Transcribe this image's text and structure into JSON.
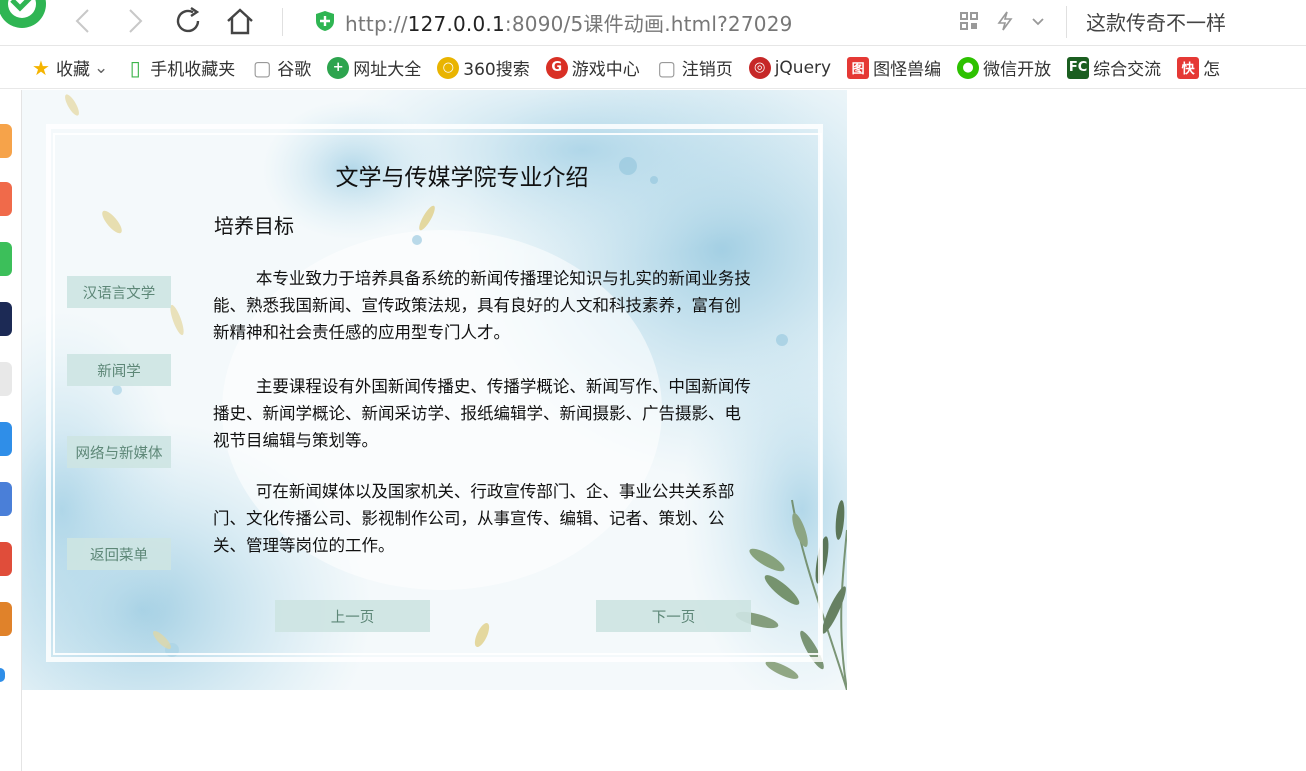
{
  "browser": {
    "url_prefix": "http://",
    "url_host": "127.0.0.1",
    "url_rest": ":8090/5课件动画.html?27029",
    "slogan": "这款传奇不一样",
    "icons": [
      "back-icon",
      "forward-icon",
      "reload-icon",
      "home-icon",
      "security-shield-icon",
      "qr-code-icon",
      "lightning-icon",
      "chevron-down-icon"
    ]
  },
  "bookmarks": [
    {
      "label": "收藏",
      "icon": "star-icon",
      "color": "#f5b400"
    },
    {
      "label": "手机收藏夹",
      "icon": "phone-icon",
      "color": "#3cb44b"
    },
    {
      "label": "谷歌",
      "icon": "page-icon",
      "color": "#999999"
    },
    {
      "label": "网址大全",
      "icon": "plus-circle-icon",
      "color": "#2da44e"
    },
    {
      "label": "360搜索",
      "icon": "360-icon",
      "color": "#e9b400"
    },
    {
      "label": "游戏中心",
      "icon": "game-icon",
      "color": "#d93025"
    },
    {
      "label": "注销页",
      "icon": "page-icon",
      "color": "#999999"
    },
    {
      "label": "jQuery",
      "icon": "jquery-icon",
      "color": "#c62828"
    },
    {
      "label": "图怪兽编",
      "icon": "tuguaishou-icon",
      "color": "#e53935"
    },
    {
      "label": "微信开放",
      "icon": "wechat-icon",
      "color": "#2dc100"
    },
    {
      "label": "综合交流",
      "icon": "fc-icon",
      "color": "#1b5e20"
    },
    {
      "label": "怎",
      "icon": "kuai-icon",
      "color": "#e53935"
    }
  ],
  "page": {
    "title": "文学与传媒学院专业介绍",
    "subtitle": "培养目标",
    "paragraphs": [
      "本专业致力于培养具备系统的新闻传播理论知识与扎实的新闻业务技能、熟悉我国新闻、宣传政策法规，具有良好的人文和科技素养，富有创新精神和社会责任感的应用型专门人才。",
      "主要课程设有外国新闻传播史、传播学概论、新闻写作、中国新闻传播史、新闻学概论、新闻采访学、报纸编辑学、新闻摄影、广告摄影、电视节目编辑与策划等。",
      "可在新闻媒体以及国家机关、行政宣传部门、企、事业公共关系部门、文化传播公司、影视制作公司，从事宣传、编辑、记者、策划、公关、管理等岗位的工作。"
    ],
    "side_buttons": [
      "汉语言文学",
      "新闻学",
      "网络与新媒体",
      "返回菜单"
    ],
    "prev_label": "上一页",
    "next_label": "下一页"
  },
  "colors": {
    "button_bg": "#cde4e2",
    "button_text": "#5d8777",
    "watercolor": "#a9d3e6"
  }
}
